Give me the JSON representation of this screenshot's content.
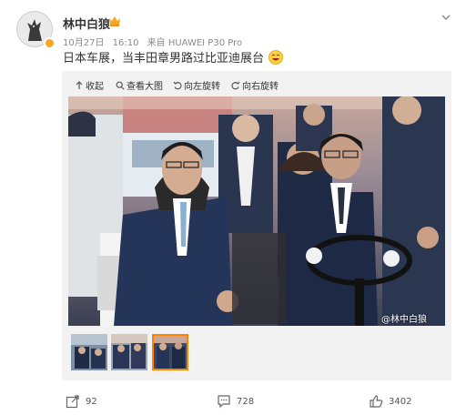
{
  "post": {
    "user": {
      "name": "林中白狼",
      "crown_icon": "crown-icon",
      "verified_badge_color": "#f5a623"
    },
    "meta": {
      "date": "10月27日",
      "time": "16:10",
      "source": "来自 HUAWEI P30 Pro"
    },
    "text": "日本车展，当丰田章男路过比亚迪展台",
    "emoji_icon": "laughing-emoji-icon",
    "media_toolbar": {
      "collapse": "收起",
      "view_large": "查看大图",
      "rotate_left": "向左旋转",
      "rotate_right": "向右旋转"
    },
    "watermark": "@林中白狼",
    "thumbnails": [
      {
        "label": "thumbnail-1",
        "active": false
      },
      {
        "label": "thumbnail-2",
        "active": false
      },
      {
        "label": "thumbnail-3",
        "active": true
      }
    ],
    "actions": {
      "repost_count": "92",
      "comment_count": "728",
      "like_count": "3402"
    }
  },
  "colors": {
    "accent": "#ff8200",
    "meta_text": "#8a8a8a"
  }
}
